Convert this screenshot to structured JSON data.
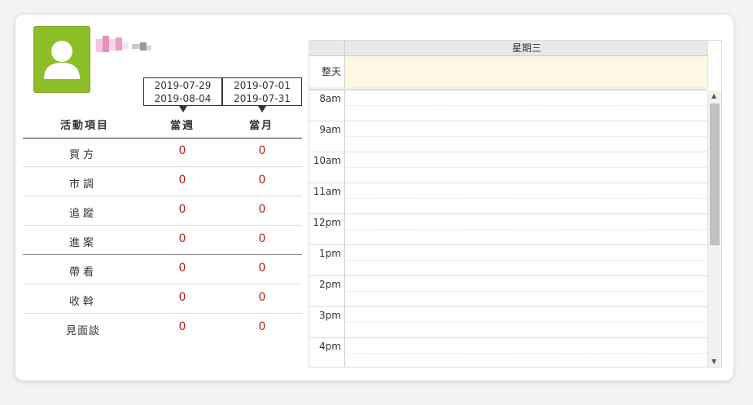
{
  "profile": {
    "avatar_icon": "user-icon",
    "avatar_color": "#8dbd27"
  },
  "periods": [
    {
      "start": "2019-07-29",
      "end": "2019-08-04",
      "label": "當週"
    },
    {
      "start": "2019-07-01",
      "end": "2019-07-31",
      "label": "當月"
    }
  ],
  "stats": {
    "header": "活動項目",
    "rows": [
      {
        "label": "買方",
        "week": "0",
        "month": "0"
      },
      {
        "label": "市調",
        "week": "0",
        "month": "0"
      },
      {
        "label": "追蹤",
        "week": "0",
        "month": "0"
      },
      {
        "label": "進案",
        "week": "0",
        "month": "0"
      },
      {
        "label": "帶看",
        "week": "0",
        "month": "0"
      },
      {
        "label": "收斡",
        "week": "0",
        "month": "0"
      },
      {
        "label": "見面談",
        "week": "0",
        "month": "0"
      }
    ]
  },
  "calendar": {
    "day_header": "星期三",
    "allday_label": "整天",
    "hours": [
      "8am",
      "9am",
      "10am",
      "11am",
      "12pm",
      "1pm",
      "2pm",
      "3pm",
      "4pm"
    ]
  }
}
